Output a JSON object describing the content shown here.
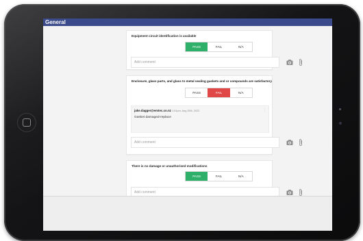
{
  "app": {
    "header_title": "General"
  },
  "segment_labels": {
    "pass": "PASS",
    "fail": "FAIL",
    "na": "N/A"
  },
  "items": [
    {
      "question": "Equipment circuit identification is available",
      "selected": "PASS",
      "comment_placeholder": "Add comment"
    },
    {
      "question": "Enclosure, glass parts, and glass to metal sealing gaskets and or compounds are satisfactory",
      "selected": "FAIL",
      "note": {
        "author": "jake.dagger@emtec.co.nz",
        "time": "1:51pm, Aug 25th, 2022",
        "text": "Gasket damaged-replace"
      },
      "comment_placeholder": "Add comment"
    },
    {
      "question": "There is no damage or unauthorised modifications",
      "selected": "PASS",
      "comment_placeholder": "Add comment"
    }
  ],
  "colors": {
    "header": "#3b4a8a",
    "pass": "#2fb06a",
    "fail": "#e04848"
  },
  "icons": {
    "camera": "camera-icon",
    "attach": "paperclip-icon",
    "menu": "more-vertical-icon",
    "home": "home-button"
  }
}
